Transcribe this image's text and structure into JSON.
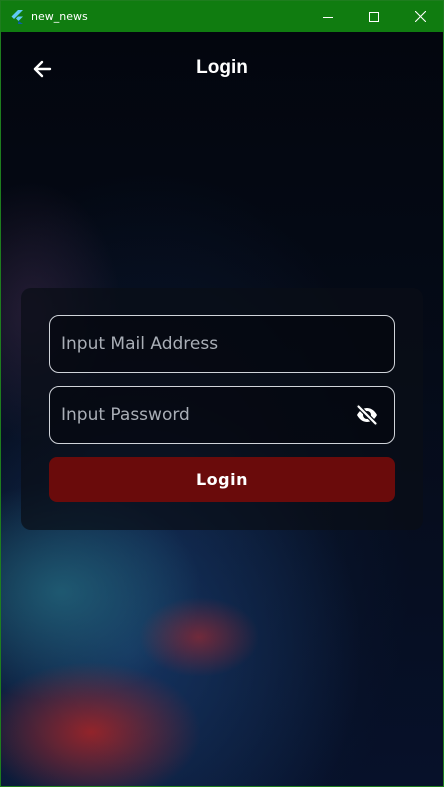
{
  "window": {
    "title": "new_news",
    "controls": [
      "minimize",
      "maximize",
      "close"
    ]
  },
  "header": {
    "title": "Login",
    "back_icon": "arrow-left-icon"
  },
  "form": {
    "email": {
      "placeholder": "Input Mail Address",
      "value": ""
    },
    "password": {
      "placeholder": "Input Password",
      "value": "",
      "toggle_icon": "eye-off-icon"
    },
    "submit_label": "Login"
  },
  "colors": {
    "titlebar": "#107c10",
    "button": "#6a0b0b",
    "field_border": "#d0d4da",
    "text": "#ffffff"
  }
}
